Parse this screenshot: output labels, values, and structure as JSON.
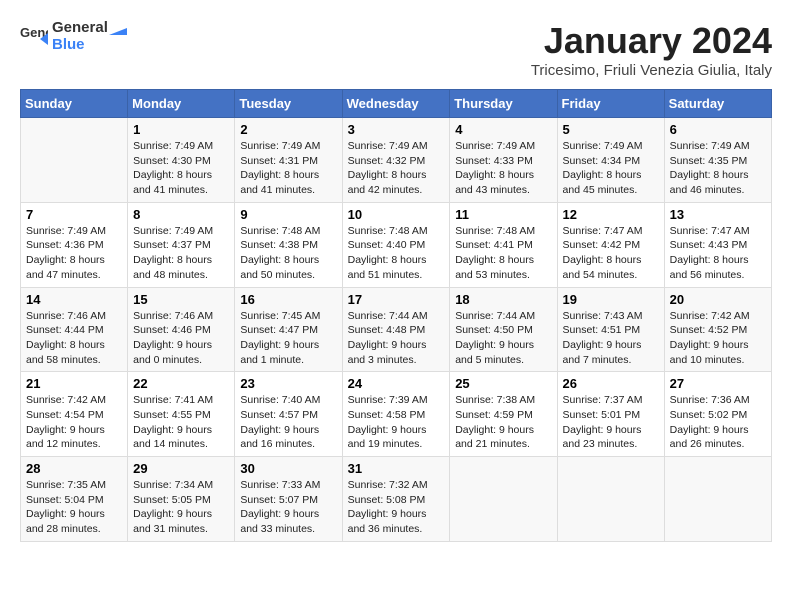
{
  "logo": {
    "line1": "General",
    "line2": "Blue"
  },
  "title": "January 2024",
  "location": "Tricesimo, Friuli Venezia Giulia, Italy",
  "weekdays": [
    "Sunday",
    "Monday",
    "Tuesday",
    "Wednesday",
    "Thursday",
    "Friday",
    "Saturday"
  ],
  "weeks": [
    [
      {
        "day": "",
        "sunrise": "",
        "sunset": "",
        "daylight": ""
      },
      {
        "day": "1",
        "sunrise": "Sunrise: 7:49 AM",
        "sunset": "Sunset: 4:30 PM",
        "daylight": "Daylight: 8 hours and 41 minutes."
      },
      {
        "day": "2",
        "sunrise": "Sunrise: 7:49 AM",
        "sunset": "Sunset: 4:31 PM",
        "daylight": "Daylight: 8 hours and 41 minutes."
      },
      {
        "day": "3",
        "sunrise": "Sunrise: 7:49 AM",
        "sunset": "Sunset: 4:32 PM",
        "daylight": "Daylight: 8 hours and 42 minutes."
      },
      {
        "day": "4",
        "sunrise": "Sunrise: 7:49 AM",
        "sunset": "Sunset: 4:33 PM",
        "daylight": "Daylight: 8 hours and 43 minutes."
      },
      {
        "day": "5",
        "sunrise": "Sunrise: 7:49 AM",
        "sunset": "Sunset: 4:34 PM",
        "daylight": "Daylight: 8 hours and 45 minutes."
      },
      {
        "day": "6",
        "sunrise": "Sunrise: 7:49 AM",
        "sunset": "Sunset: 4:35 PM",
        "daylight": "Daylight: 8 hours and 46 minutes."
      }
    ],
    [
      {
        "day": "7",
        "sunrise": "Sunrise: 7:49 AM",
        "sunset": "Sunset: 4:36 PM",
        "daylight": "Daylight: 8 hours and 47 minutes."
      },
      {
        "day": "8",
        "sunrise": "Sunrise: 7:49 AM",
        "sunset": "Sunset: 4:37 PM",
        "daylight": "Daylight: 8 hours and 48 minutes."
      },
      {
        "day": "9",
        "sunrise": "Sunrise: 7:48 AM",
        "sunset": "Sunset: 4:38 PM",
        "daylight": "Daylight: 8 hours and 50 minutes."
      },
      {
        "day": "10",
        "sunrise": "Sunrise: 7:48 AM",
        "sunset": "Sunset: 4:40 PM",
        "daylight": "Daylight: 8 hours and 51 minutes."
      },
      {
        "day": "11",
        "sunrise": "Sunrise: 7:48 AM",
        "sunset": "Sunset: 4:41 PM",
        "daylight": "Daylight: 8 hours and 53 minutes."
      },
      {
        "day": "12",
        "sunrise": "Sunrise: 7:47 AM",
        "sunset": "Sunset: 4:42 PM",
        "daylight": "Daylight: 8 hours and 54 minutes."
      },
      {
        "day": "13",
        "sunrise": "Sunrise: 7:47 AM",
        "sunset": "Sunset: 4:43 PM",
        "daylight": "Daylight: 8 hours and 56 minutes."
      }
    ],
    [
      {
        "day": "14",
        "sunrise": "Sunrise: 7:46 AM",
        "sunset": "Sunset: 4:44 PM",
        "daylight": "Daylight: 8 hours and 58 minutes."
      },
      {
        "day": "15",
        "sunrise": "Sunrise: 7:46 AM",
        "sunset": "Sunset: 4:46 PM",
        "daylight": "Daylight: 9 hours and 0 minutes."
      },
      {
        "day": "16",
        "sunrise": "Sunrise: 7:45 AM",
        "sunset": "Sunset: 4:47 PM",
        "daylight": "Daylight: 9 hours and 1 minute."
      },
      {
        "day": "17",
        "sunrise": "Sunrise: 7:44 AM",
        "sunset": "Sunset: 4:48 PM",
        "daylight": "Daylight: 9 hours and 3 minutes."
      },
      {
        "day": "18",
        "sunrise": "Sunrise: 7:44 AM",
        "sunset": "Sunset: 4:50 PM",
        "daylight": "Daylight: 9 hours and 5 minutes."
      },
      {
        "day": "19",
        "sunrise": "Sunrise: 7:43 AM",
        "sunset": "Sunset: 4:51 PM",
        "daylight": "Daylight: 9 hours and 7 minutes."
      },
      {
        "day": "20",
        "sunrise": "Sunrise: 7:42 AM",
        "sunset": "Sunset: 4:52 PM",
        "daylight": "Daylight: 9 hours and 10 minutes."
      }
    ],
    [
      {
        "day": "21",
        "sunrise": "Sunrise: 7:42 AM",
        "sunset": "Sunset: 4:54 PM",
        "daylight": "Daylight: 9 hours and 12 minutes."
      },
      {
        "day": "22",
        "sunrise": "Sunrise: 7:41 AM",
        "sunset": "Sunset: 4:55 PM",
        "daylight": "Daylight: 9 hours and 14 minutes."
      },
      {
        "day": "23",
        "sunrise": "Sunrise: 7:40 AM",
        "sunset": "Sunset: 4:57 PM",
        "daylight": "Daylight: 9 hours and 16 minutes."
      },
      {
        "day": "24",
        "sunrise": "Sunrise: 7:39 AM",
        "sunset": "Sunset: 4:58 PM",
        "daylight": "Daylight: 9 hours and 19 minutes."
      },
      {
        "day": "25",
        "sunrise": "Sunrise: 7:38 AM",
        "sunset": "Sunset: 4:59 PM",
        "daylight": "Daylight: 9 hours and 21 minutes."
      },
      {
        "day": "26",
        "sunrise": "Sunrise: 7:37 AM",
        "sunset": "Sunset: 5:01 PM",
        "daylight": "Daylight: 9 hours and 23 minutes."
      },
      {
        "day": "27",
        "sunrise": "Sunrise: 7:36 AM",
        "sunset": "Sunset: 5:02 PM",
        "daylight": "Daylight: 9 hours and 26 minutes."
      }
    ],
    [
      {
        "day": "28",
        "sunrise": "Sunrise: 7:35 AM",
        "sunset": "Sunset: 5:04 PM",
        "daylight": "Daylight: 9 hours and 28 minutes."
      },
      {
        "day": "29",
        "sunrise": "Sunrise: 7:34 AM",
        "sunset": "Sunset: 5:05 PM",
        "daylight": "Daylight: 9 hours and 31 minutes."
      },
      {
        "day": "30",
        "sunrise": "Sunrise: 7:33 AM",
        "sunset": "Sunset: 5:07 PM",
        "daylight": "Daylight: 9 hours and 33 minutes."
      },
      {
        "day": "31",
        "sunrise": "Sunrise: 7:32 AM",
        "sunset": "Sunset: 5:08 PM",
        "daylight": "Daylight: 9 hours and 36 minutes."
      },
      {
        "day": "",
        "sunrise": "",
        "sunset": "",
        "daylight": ""
      },
      {
        "day": "",
        "sunrise": "",
        "sunset": "",
        "daylight": ""
      },
      {
        "day": "",
        "sunrise": "",
        "sunset": "",
        "daylight": ""
      }
    ]
  ]
}
